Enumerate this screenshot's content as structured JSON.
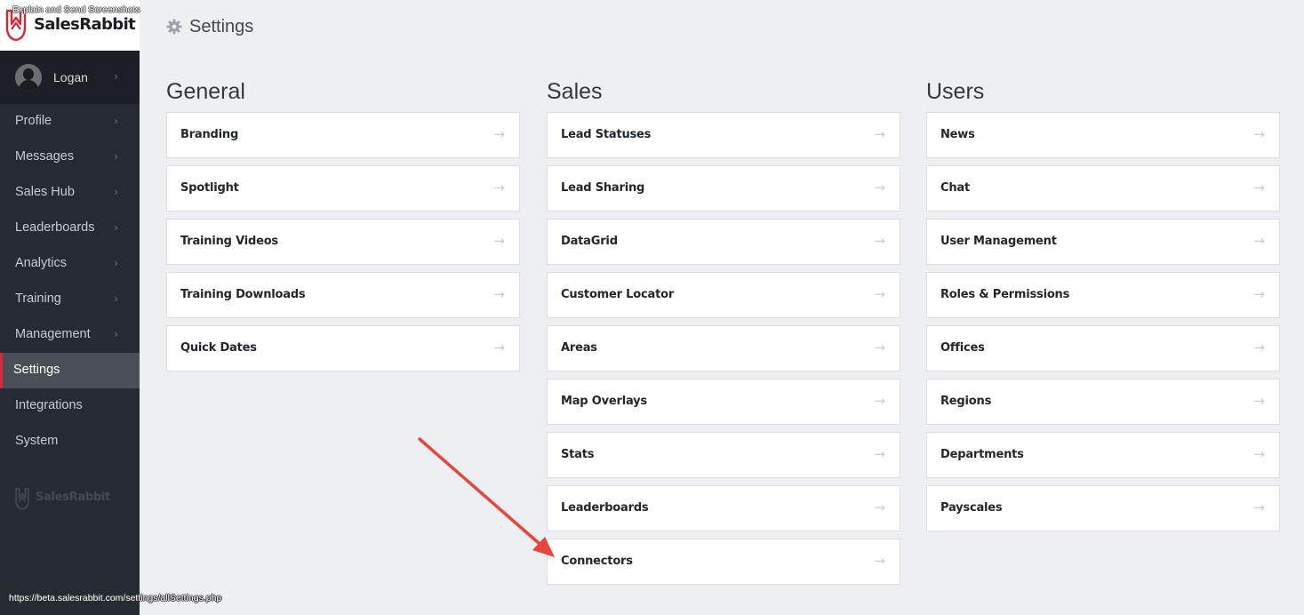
{
  "overlay_note": "Explain and Send Screenshots",
  "brand": {
    "name": "SalesRabbit",
    "accent": "#d6283b"
  },
  "user": {
    "name": "Logan"
  },
  "nav": [
    {
      "label": "Profile",
      "has_chevron": true
    },
    {
      "label": "Messages",
      "has_chevron": true
    },
    {
      "label": "Sales Hub",
      "has_chevron": true
    },
    {
      "label": "Leaderboards",
      "has_chevron": true
    },
    {
      "label": "Analytics",
      "has_chevron": true
    },
    {
      "label": "Training",
      "has_chevron": true
    },
    {
      "label": "Management",
      "has_chevron": true
    },
    {
      "label": "Settings",
      "active": true
    },
    {
      "label": "Integrations"
    },
    {
      "label": "System"
    }
  ],
  "footer_brand": "SalesRabbit",
  "status_url": "https://beta.salesrabbit.com/settings/allSettings.php",
  "page": {
    "title": "Settings",
    "icon": "gear-icon"
  },
  "sections": [
    {
      "title": "General",
      "items": [
        "Branding",
        "Spotlight",
        "Training Videos",
        "Training Downloads",
        "Quick Dates"
      ]
    },
    {
      "title": "Sales",
      "items": [
        "Lead Statuses",
        "Lead Sharing",
        "DataGrid",
        "Customer Locator",
        "Areas",
        "Map Overlays",
        "Stats",
        "Leaderboards",
        "Connectors"
      ]
    },
    {
      "title": "Users",
      "items": [
        "News",
        "Chat",
        "User Management",
        "Roles & Permissions",
        "Offices",
        "Regions",
        "Departments",
        "Payscales"
      ]
    }
  ],
  "item_arrow": "→",
  "annotation": {
    "type": "arrow",
    "color": "#e8453c",
    "points_to": "Connectors"
  }
}
